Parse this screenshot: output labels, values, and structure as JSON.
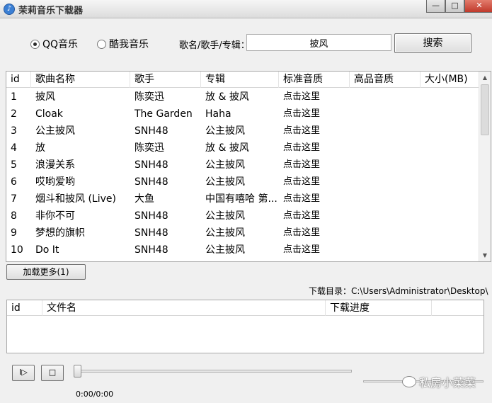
{
  "window": {
    "title": "茉莉音乐下载器",
    "icon": "music-note-icon",
    "controls": {
      "minimize": "—",
      "maximize": "□",
      "close": "✕"
    }
  },
  "search": {
    "sources": [
      {
        "label": "QQ音乐",
        "selected": true
      },
      {
        "label": "酷我音乐",
        "selected": false
      }
    ],
    "label": "歌名/歌手/专辑：",
    "value": "披风",
    "button_label": "搜索"
  },
  "results": {
    "columns": [
      "id",
      "歌曲名称",
      "歌手",
      "专辑",
      "标准音质",
      "高品音质",
      "大小(MB)"
    ],
    "rows": [
      {
        "id": "1",
        "name": "披风",
        "artist": "陈奕迅",
        "album": "放 & 披风",
        "standard": "点击这里",
        "high": "",
        "size": ""
      },
      {
        "id": "2",
        "name": "Cloak",
        "artist": "The Garden",
        "album": "Haha",
        "standard": "点击这里",
        "high": "",
        "size": ""
      },
      {
        "id": "3",
        "name": "公主披风",
        "artist": "SNH48",
        "album": "公主披风",
        "standard": "点击这里",
        "high": "",
        "size": ""
      },
      {
        "id": "4",
        "name": "放",
        "artist": "陈奕迅",
        "album": "放 & 披风",
        "standard": "点击这里",
        "high": "",
        "size": ""
      },
      {
        "id": "5",
        "name": "浪漫关系",
        "artist": "SNH48",
        "album": "公主披风",
        "standard": "点击这里",
        "high": "",
        "size": ""
      },
      {
        "id": "6",
        "name": "哎哟爱哟",
        "artist": "SNH48",
        "album": "公主披风",
        "standard": "点击这里",
        "high": "",
        "size": ""
      },
      {
        "id": "7",
        "name": "烟斗和披风 (Live)",
        "artist": "大鱼",
        "album": "中国有嘻哈 第...",
        "standard": "点击这里",
        "high": "",
        "size": ""
      },
      {
        "id": "8",
        "name": "非你不可",
        "artist": "SNH48",
        "album": "公主披风",
        "standard": "点击这里",
        "high": "",
        "size": ""
      },
      {
        "id": "9",
        "name": "梦想的旗帜",
        "artist": "SNH48",
        "album": "公主披风",
        "standard": "点击这里",
        "high": "",
        "size": ""
      },
      {
        "id": "10",
        "name": "Do It",
        "artist": "SNH48",
        "album": "公主披风",
        "standard": "点击这里",
        "high": "",
        "size": ""
      }
    ]
  },
  "load_more_label": "加载更多(1)",
  "download_dir": "下载目录：C:\\Users\\Administrator\\Desktop\\",
  "downloads": {
    "columns": [
      "id",
      "文件名",
      "下载进度"
    ]
  },
  "player": {
    "play_label": "I▷",
    "stop_label": "□",
    "time": "0:00/0:00",
    "progress": 0
  },
  "watermark": "私房小菜菜"
}
